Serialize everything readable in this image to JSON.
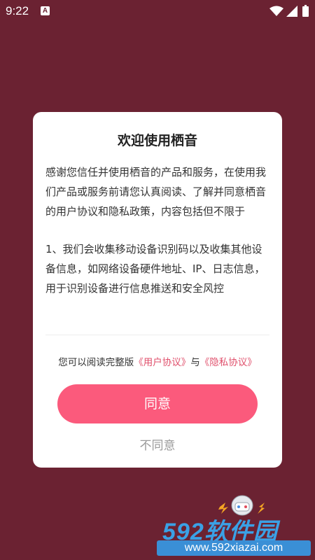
{
  "status_bar": {
    "time": "9:22",
    "notification_badge": "A",
    "icons": [
      "wifi-icon",
      "signal-icon",
      "battery-icon"
    ]
  },
  "dialog": {
    "title": "欢迎使用栖音",
    "paragraphs": [
      "感谢您信任并使用栖音的产品和服务，在使用我们产品或服务前请您认真阅读、了解并同意栖音的用户协议和隐私政策，内容包括但不限于",
      " 1、我们会收集移动设备识别码以及收集其他设备信息，如网络设备硬件地址、IP、日志信息，用于识别设备进行信息推送和安全风控"
    ],
    "agreement": {
      "prefix": "您可以阅读完整版",
      "user_agreement": "《用户协议》",
      "joiner": "与",
      "privacy_agreement": "《隐私协议》"
    },
    "agree_label": "同意",
    "disagree_label": "不同意"
  },
  "watermark": {
    "brand": "592软件园",
    "url": "www.592xiazai.com"
  },
  "colors": {
    "background": "#6b2232",
    "accent": "#fb5a7c",
    "link": "#e0506c"
  }
}
